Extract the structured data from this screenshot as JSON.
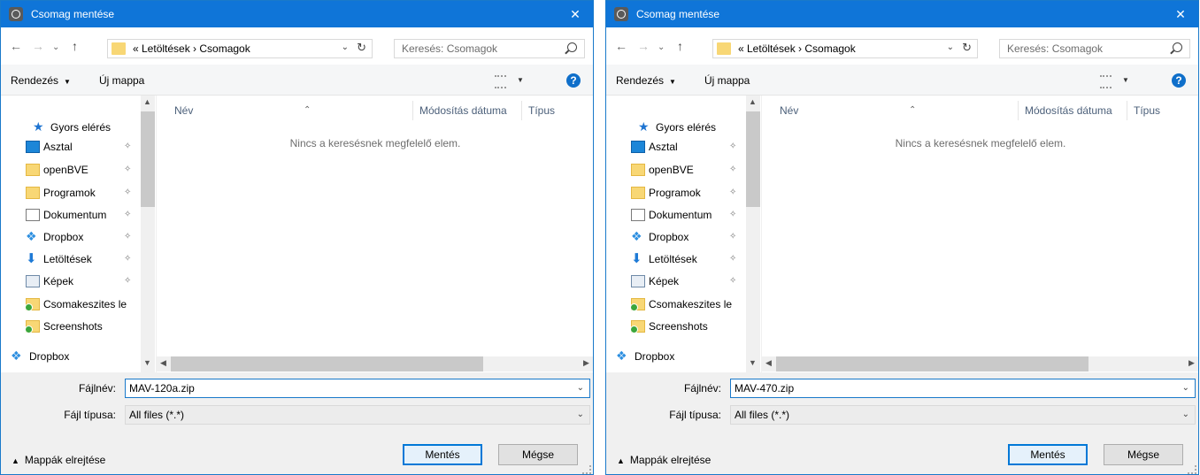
{
  "dialogs": [
    {
      "title": "Csomag mentése",
      "close_glyph": "✕",
      "address": "« Letöltések › Csomagok",
      "search_placeholder": "Keresés: Csomagok",
      "toolbar": {
        "organize": "Rendezés",
        "new_folder": "Új mappa",
        "help": "?"
      },
      "quick_access": "Gyors elérés",
      "nav_items": [
        "Asztal",
        "openBVE",
        "Programok",
        "Dokumentum",
        "Dropbox",
        "Letöltések",
        "Képek",
        "Csomakeszites le",
        "Screenshots"
      ],
      "dropbox_root": "Dropbox",
      "columns": {
        "name": "Név",
        "modified": "Módosítás dátuma",
        "type": "Típus"
      },
      "empty_message": "Nincs a keresésnek megfelelő elem.",
      "filename_label": "Fájlnév:",
      "filename_value": "MAV-120a.zip",
      "filetype_label": "Fájl típusa:",
      "filetype_value": "All files (*.*)",
      "hide_folders": "Mappák elrejtése",
      "save_button": "Mentés",
      "cancel_button": "Mégse"
    },
    {
      "title": "Csomag mentése",
      "close_glyph": "✕",
      "address": "« Letöltések › Csomagok",
      "search_placeholder": "Keresés: Csomagok",
      "toolbar": {
        "organize": "Rendezés",
        "new_folder": "Új mappa",
        "help": "?"
      },
      "quick_access": "Gyors elérés",
      "nav_items": [
        "Asztal",
        "openBVE",
        "Programok",
        "Dokumentum",
        "Dropbox",
        "Letöltések",
        "Képek",
        "Csomakeszites le",
        "Screenshots"
      ],
      "dropbox_root": "Dropbox",
      "columns": {
        "name": "Név",
        "modified": "Módosítás dátuma",
        "type": "Típus"
      },
      "empty_message": "Nincs a keresésnek megfelelő elem.",
      "filename_label": "Fájlnév:",
      "filename_value": "MAV-470.zip",
      "filetype_label": "Fájl típusa:",
      "filetype_value": "All files (*.*)",
      "hide_folders": "Mappák elrejtése",
      "save_button": "Mentés",
      "cancel_button": "Mégse"
    }
  ],
  "icons": [
    "back-arrow-icon",
    "forward-arrow-icon",
    "up-arrow-icon",
    "refresh-icon",
    "search-icon",
    "pin-icon",
    "folder-icon",
    "help-icon"
  ]
}
